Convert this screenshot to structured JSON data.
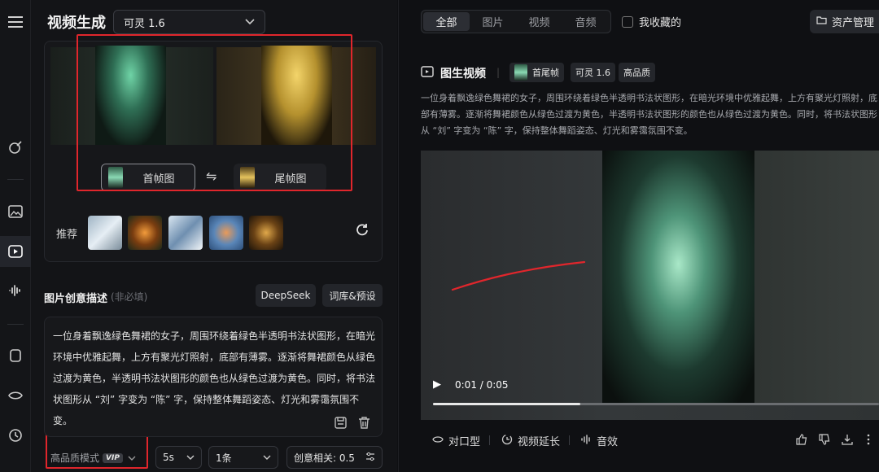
{
  "header": {
    "title": "视频生成",
    "model": "可灵 1.6"
  },
  "frames": {
    "first_label": "首帧图",
    "last_label": "尾帧图"
  },
  "recommend": {
    "label": "推荐"
  },
  "description": {
    "label": "图片创意描述",
    "optional": "(非必填)",
    "deepseek": "DeepSeek",
    "presets": "词库&预设",
    "text": "一位身着飘逸绿色舞裙的女子，周围环绕着绿色半透明书法状图形，在暗光环境中优雅起舞，上方有聚光灯照射，底部有薄雾。逐渐将舞裙颜色从绿色过渡为黄色，半透明书法状图形的颜色也从绿色过渡为黄色。同时，将书法状图形从 “刘” 字变为 “陈” 字，保持整体舞蹈姿态、灯光和雾霭氛围不变。"
  },
  "settings": {
    "quality_mode": "高品质模式",
    "vip": "VIP",
    "duration": "5s",
    "count": "1条",
    "creativity": "创意相关: 0.5"
  },
  "filters": {
    "tabs": [
      "全部",
      "图片",
      "视频",
      "音频"
    ],
    "active_tab": 0,
    "favorites": "我收藏的",
    "asset_manager": "资产管理"
  },
  "result": {
    "title": "图生视频",
    "chips": [
      "首尾帧",
      "可灵 1.6",
      "高品质"
    ],
    "prompt": "一位身着飘逸绿色舞裙的女子，周围环绕着绿色半透明书法状图形，在暗光环境中优雅起舞，上方有聚光灯照射，底部有薄雾。逐渐将舞裙颜色从绿色过渡为黄色，半透明书法状图形的颜色也从绿色过渡为黄色。同时，将书法状图形从 “刘” 字变为 “陈” 字，保持整体舞蹈姿态、灯光和雾霭氛围不变。",
    "time": "0:01 / 0:05",
    "progress": 0.33,
    "actions": [
      "对口型",
      "视频延长",
      "音效"
    ]
  },
  "colors": {
    "accent_red": "#e0262c",
    "background": "#0f1013"
  }
}
